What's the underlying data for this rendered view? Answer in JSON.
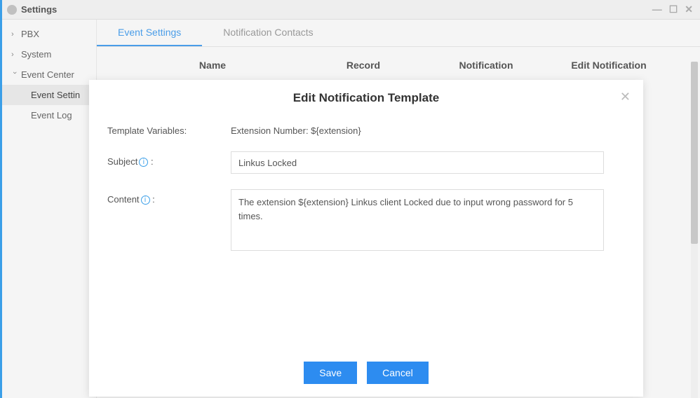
{
  "window": {
    "title": "Settings"
  },
  "sidebar": {
    "items": [
      {
        "label": "PBX",
        "expanded": false
      },
      {
        "label": "System",
        "expanded": false
      },
      {
        "label": "Event Center",
        "expanded": true
      }
    ],
    "subitems": [
      {
        "label": "Event Settin",
        "active": true
      },
      {
        "label": "Event Log",
        "active": false
      }
    ]
  },
  "tabs": [
    {
      "label": "Event Settings",
      "active": true
    },
    {
      "label": "Notification Contacts",
      "active": false
    }
  ],
  "table": {
    "headers": {
      "name": "Name",
      "record": "Record",
      "notification": "Notification",
      "edit": "Edit Notification"
    }
  },
  "modal": {
    "title": "Edit Notification Template",
    "template_variables_label": "Template Variables:",
    "template_variables_value": "Extension Number: ${extension}",
    "subject_label": "Subject",
    "subject_value": "Linkus Locked",
    "content_label": "Content",
    "content_value": "The extension ${extension} Linkus client Locked due to input wrong password for 5 times.",
    "save_label": "Save",
    "cancel_label": "Cancel"
  }
}
